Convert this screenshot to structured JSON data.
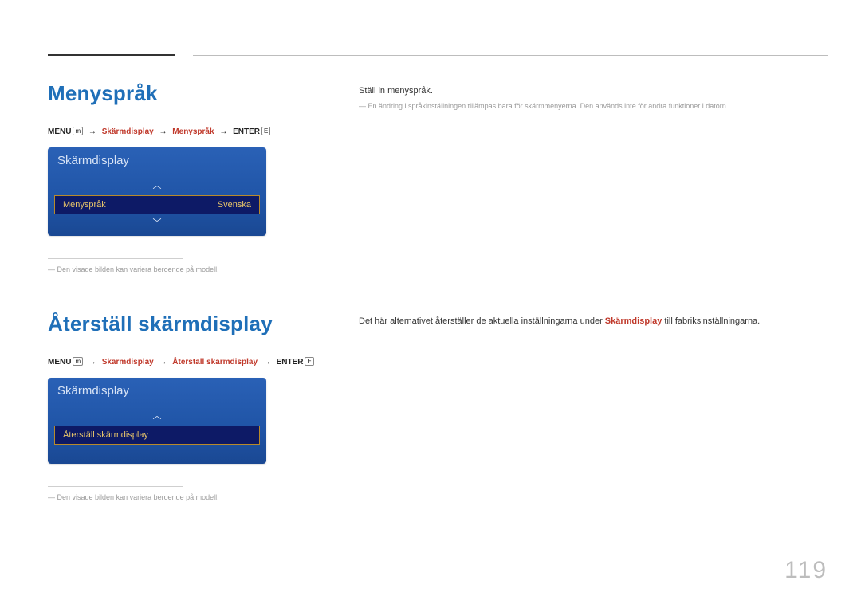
{
  "page_number": "119",
  "section1": {
    "title": "Menyspråk",
    "breadcrumb": {
      "menu": "MENU",
      "menu_glyph": "m",
      "p1": "Skärmdisplay",
      "p2": "Menyspråk",
      "enter": "ENTER",
      "enter_glyph": "E"
    },
    "osd": {
      "header": "Skärmdisplay",
      "row_label": "Menyspråk",
      "row_value": "Svenska"
    },
    "footnote": "Den visade bilden kan variera beroende på modell.",
    "body_line1": "Ställ in menyspråk.",
    "body_note": "En ändring i språkinställningen tillämpas bara för skärmmenyerna. Den används inte för andra funktioner i datorn."
  },
  "section2": {
    "title": "Återställ skärmdisplay",
    "breadcrumb": {
      "menu": "MENU",
      "menu_glyph": "m",
      "p1": "Skärmdisplay",
      "p2": "Återställ skärmdisplay",
      "enter": "ENTER",
      "enter_glyph": "E"
    },
    "osd": {
      "header": "Skärmdisplay",
      "row_label": "Återställ skärmdisplay"
    },
    "footnote": "Den visade bilden kan variera beroende på modell.",
    "body_pre": "Det här alternativet återställer de aktuella inställningarna under ",
    "body_emph": "Skärmdisplay",
    "body_post": " till fabriksinställningarna."
  }
}
